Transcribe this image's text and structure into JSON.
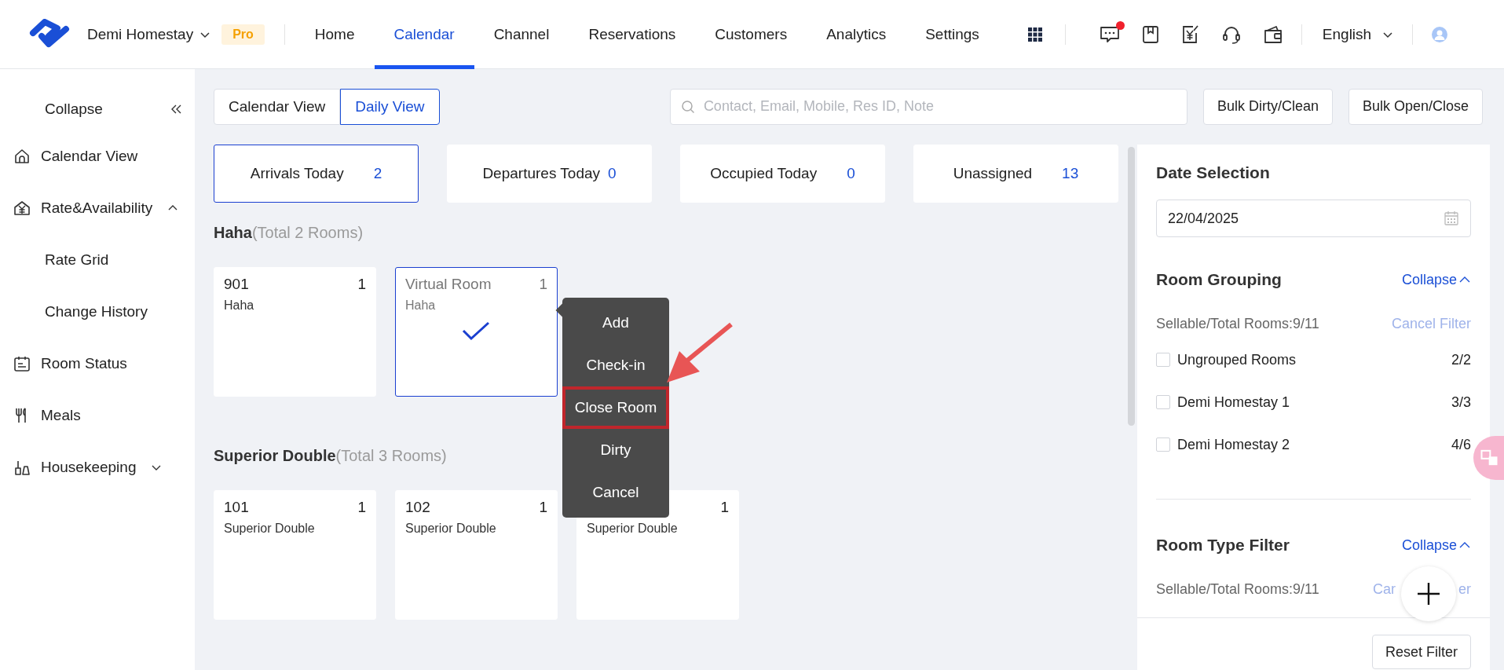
{
  "brand": {
    "name": "Demi Homestay",
    "plan": "Pro"
  },
  "nav": [
    {
      "label": "Home",
      "selected": false
    },
    {
      "label": "Calendar",
      "selected": true
    },
    {
      "label": "Channel",
      "selected": false
    },
    {
      "label": "Reservations",
      "selected": false
    },
    {
      "label": "Customers",
      "selected": false
    },
    {
      "label": "Analytics",
      "selected": false
    },
    {
      "label": "Settings",
      "selected": false
    }
  ],
  "messages": {
    "unread": true
  },
  "language": "English",
  "sidebar": {
    "collapse": "Collapse",
    "items": [
      {
        "label": "Calendar View"
      },
      {
        "label": "Rate&Availability",
        "expanded": true,
        "children": [
          {
            "label": "Rate Grid"
          },
          {
            "label": "Change History"
          }
        ]
      },
      {
        "label": "Room Status"
      },
      {
        "label": "Meals"
      },
      {
        "label": "Housekeeping",
        "expanded": false
      }
    ]
  },
  "views": [
    {
      "label": "Calendar View",
      "selected": false
    },
    {
      "label": "Daily View",
      "selected": true
    }
  ],
  "search": {
    "placeholder": "Contact, Email, Mobile, Res ID, Note"
  },
  "bulk_buttons": [
    "Bulk Dirty/Clean",
    "Bulk Open/Close"
  ],
  "stats": [
    {
      "label": "Arrivals Today",
      "value": "2",
      "selected": true
    },
    {
      "label": "Departures Today",
      "value": "0",
      "selected": false
    },
    {
      "label": "Occupied Today",
      "value": "0",
      "selected": false
    },
    {
      "label": "Unassigned",
      "value": "13",
      "selected": false
    }
  ],
  "room_groups": [
    {
      "name": "Haha",
      "total": "(Total 2 Rooms)",
      "rooms": [
        {
          "kind": "room",
          "number": "901",
          "count": "1",
          "type": "Haha",
          "selected": false
        },
        {
          "kind": "virtual",
          "number": "Virtual Room",
          "count": "1",
          "type": "Haha",
          "selected": true
        }
      ]
    },
    {
      "name": "Superior Double",
      "total": "(Total 3 Rooms)",
      "rooms": [
        {
          "kind": "room",
          "number": "101",
          "count": "1",
          "type": "Superior Double",
          "selected": false
        },
        {
          "kind": "room",
          "number": "102",
          "count": "1",
          "type": "Superior Double",
          "selected": false
        },
        {
          "kind": "room",
          "count": "1",
          "type": "Superior Double",
          "selected": false
        }
      ]
    }
  ],
  "context_menu": [
    {
      "label": "Add",
      "highlighted": false
    },
    {
      "label": "Check-in",
      "highlighted": false
    },
    {
      "label": "Close Room",
      "highlighted": true
    },
    {
      "label": "Dirty",
      "highlighted": false
    },
    {
      "label": "Cancel",
      "highlighted": false
    }
  ],
  "filters": {
    "date_title": "Date Selection",
    "date": "22/04/2025",
    "sections": [
      {
        "title": "Room Grouping",
        "toggle": "Collapse",
        "summary": "Sellable/Total Rooms:9/11",
        "clear": "Cancel Filter",
        "disabled": true,
        "options": [
          {
            "label": "Ungrouped Rooms",
            "count": "2/2",
            "checked": false
          },
          {
            "label": "Demi Homestay 1",
            "count": "3/3",
            "checked": false
          },
          {
            "label": "Demi Homestay 2",
            "count": "4/6",
            "checked": false
          }
        ]
      },
      {
        "title": "Room Type Filter",
        "toggle": "Collapse",
        "summary": "Sellable/Total Rooms:9/11",
        "clear_parts": [
          "Car",
          "er"
        ],
        "disabled": true
      }
    ],
    "reset": "Reset Filter"
  }
}
